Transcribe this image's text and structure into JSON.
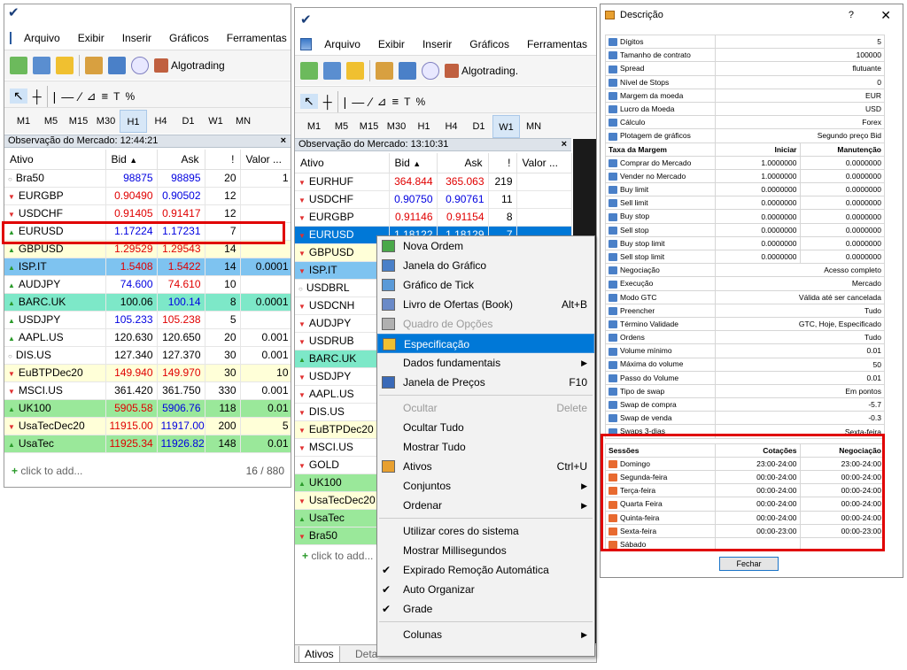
{
  "menu": {
    "items": [
      "Arquivo",
      "Exibir",
      "Inserir",
      "Gráficos",
      "Ferramentas"
    ]
  },
  "toolbar": {
    "algo_label": "Algotrading",
    "algo_label2": "Algotrading."
  },
  "timeframes": [
    "M1",
    "M5",
    "M15",
    "M30",
    "H1",
    "H4",
    "D1",
    "W1",
    "MN"
  ],
  "left": {
    "header": "Observação do Mercado: 12:44:21",
    "columns": [
      "Ativo",
      "Bid",
      "Ask",
      "!",
      "Valor ..."
    ],
    "rows": [
      {
        "sym": "Bra50",
        "bid": "98875",
        "ask": "98895",
        "s": "20",
        "v": "1",
        "dir": "nt",
        "bg": "#ffffff",
        "bidc": "blue",
        "askc": "blue"
      },
      {
        "sym": "EURGBP",
        "bid": "0.90490",
        "ask": "0.90502",
        "s": "12",
        "v": "",
        "dir": "dn",
        "bg": "#ffffff",
        "bidc": "red",
        "askc": "blue"
      },
      {
        "sym": "USDCHF",
        "bid": "0.91405",
        "ask": "0.91417",
        "s": "12",
        "v": "",
        "dir": "dn",
        "bg": "#ffffff",
        "bidc": "red",
        "askc": "red"
      },
      {
        "sym": "EURUSD",
        "bid": "1.17224",
        "ask": "1.17231",
        "s": "7",
        "v": "",
        "dir": "up",
        "bg": "#ffffff",
        "bidc": "blue",
        "askc": "blue"
      },
      {
        "sym": "GBPUSD",
        "bid": "1.29529",
        "ask": "1.29543",
        "s": "14",
        "v": "",
        "dir": "up",
        "bg": "#ffffd8",
        "bidc": "red",
        "askc": "red"
      },
      {
        "sym": "ISP.IT",
        "bid": "1.5408",
        "ask": "1.5422",
        "s": "14",
        "v": "0.0001",
        "dir": "up",
        "bg": "#7ec3f0",
        "bidc": "red",
        "askc": "red"
      },
      {
        "sym": "AUDJPY",
        "bid": "74.600",
        "ask": "74.610",
        "s": "10",
        "v": "",
        "dir": "up",
        "bg": "#ffffff",
        "bidc": "blue",
        "askc": "red"
      },
      {
        "sym": "BARC.UK",
        "bid": "100.06",
        "ask": "100.14",
        "s": "8",
        "v": "0.0001",
        "dir": "up",
        "bg": "#7de8c8",
        "bidc": "",
        "askc": "blue"
      },
      {
        "sym": "USDJPY",
        "bid": "105.233",
        "ask": "105.238",
        "s": "5",
        "v": "",
        "dir": "up",
        "bg": "#ffffff",
        "bidc": "blue",
        "askc": "red"
      },
      {
        "sym": "AAPL.US",
        "bid": "120.630",
        "ask": "120.650",
        "s": "20",
        "v": "0.001",
        "dir": "up",
        "bg": "#ffffff",
        "bidc": "",
        "askc": ""
      },
      {
        "sym": "DIS.US",
        "bid": "127.340",
        "ask": "127.370",
        "s": "30",
        "v": "0.001",
        "dir": "nt",
        "bg": "#ffffff",
        "bidc": "",
        "askc": ""
      },
      {
        "sym": "EuBTPDec20",
        "bid": "149.940",
        "ask": "149.970",
        "s": "30",
        "v": "10",
        "dir": "dn",
        "bg": "#ffffd8",
        "bidc": "red",
        "askc": "red"
      },
      {
        "sym": "MSCI.US",
        "bid": "361.420",
        "ask": "361.750",
        "s": "330",
        "v": "0.001",
        "dir": "dn",
        "bg": "#ffffff",
        "bidc": "",
        "askc": ""
      },
      {
        "sym": "UK100",
        "bid": "5905.58",
        "ask": "5906.76",
        "s": "118",
        "v": "0.01",
        "dir": "up",
        "bg": "#9ae89a",
        "bidc": "red",
        "askc": "blue"
      },
      {
        "sym": "UsaTecDec20",
        "bid": "11915.00",
        "ask": "11917.00",
        "s": "200",
        "v": "5",
        "dir": "dn",
        "bg": "#ffffd8",
        "bidc": "red",
        "askc": "blue"
      },
      {
        "sym": "UsaTec",
        "bid": "11925.34",
        "ask": "11926.82",
        "s": "148",
        "v": "0.01",
        "dir": "up",
        "bg": "#9ae89a",
        "bidc": "red",
        "askc": "blue"
      }
    ],
    "add": "click to add...",
    "count": "16 / 880"
  },
  "mid": {
    "header": "Observação do Mercado: 13:10:31",
    "columns": [
      "Ativo",
      "Bid",
      "Ask",
      "!",
      "Valor ..."
    ],
    "rows": [
      {
        "sym": "EURHUF",
        "bid": "364.844",
        "ask": "365.063",
        "s": "219",
        "dir": "dn",
        "bg": "#ffffff",
        "bidc": "red",
        "askc": "red"
      },
      {
        "sym": "USDCHF",
        "bid": "0.90750",
        "ask": "0.90761",
        "s": "11",
        "dir": "dn",
        "bg": "#ffffff",
        "bidc": "blue",
        "askc": "blue"
      },
      {
        "sym": "EURGBP",
        "bid": "0.91146",
        "ask": "0.91154",
        "s": "8",
        "dir": "dn",
        "bg": "#ffffff",
        "bidc": "red",
        "askc": "red"
      },
      {
        "sym": "EURUSD",
        "bid": "1.18122",
        "ask": "1.18129",
        "s": "7",
        "dir": "dn",
        "bg": "#0078d7",
        "bidc": "",
        "askc": ""
      },
      {
        "sym": "GBPUSD",
        "bid": "",
        "ask": "",
        "s": "",
        "dir": "dn",
        "bg": "#ffffd8",
        "bidc": "",
        "askc": ""
      },
      {
        "sym": "ISP.IT",
        "bid": "",
        "ask": "",
        "s": "",
        "dir": "dn",
        "bg": "#7ec3f0",
        "bidc": "",
        "askc": ""
      },
      {
        "sym": "USDBRL",
        "bid": "",
        "ask": "",
        "s": "",
        "dir": "nt",
        "bg": "#ffffff",
        "bidc": "",
        "askc": ""
      },
      {
        "sym": "USDCNH",
        "bid": "",
        "ask": "",
        "s": "",
        "dir": "dn",
        "bg": "#ffffff",
        "bidc": "",
        "askc": ""
      },
      {
        "sym": "AUDJPY",
        "bid": "",
        "ask": "",
        "s": "",
        "dir": "dn",
        "bg": "#ffffff",
        "bidc": "",
        "askc": ""
      },
      {
        "sym": "USDRUB",
        "bid": "",
        "ask": "",
        "s": "",
        "dir": "dn",
        "bg": "#ffffff",
        "bidc": "",
        "askc": ""
      },
      {
        "sym": "BARC.UK",
        "bid": "",
        "ask": "",
        "s": "",
        "dir": "up",
        "bg": "#7de8c8",
        "bidc": "",
        "askc": ""
      },
      {
        "sym": "USDJPY",
        "bid": "",
        "ask": "",
        "s": "",
        "dir": "dn",
        "bg": "#ffffff",
        "bidc": "",
        "askc": ""
      },
      {
        "sym": "AAPL.US",
        "bid": "",
        "ask": "",
        "s": "",
        "dir": "dn",
        "bg": "#ffffff",
        "bidc": "",
        "askc": ""
      },
      {
        "sym": "DIS.US",
        "bid": "",
        "ask": "",
        "s": "",
        "dir": "dn",
        "bg": "#ffffff",
        "bidc": "",
        "askc": ""
      },
      {
        "sym": "EuBTPDec20",
        "bid": "",
        "ask": "",
        "s": "",
        "dir": "dn",
        "bg": "#ffffd8",
        "bidc": "",
        "askc": ""
      },
      {
        "sym": "MSCI.US",
        "bid": "",
        "ask": "",
        "s": "",
        "dir": "dn",
        "bg": "#ffffff",
        "bidc": "",
        "askc": ""
      },
      {
        "sym": "GOLD",
        "bid": "",
        "ask": "",
        "s": "",
        "dir": "dn",
        "bg": "#ffffff",
        "bidc": "",
        "askc": ""
      },
      {
        "sym": "UK100",
        "bid": "",
        "ask": "",
        "s": "",
        "dir": "up",
        "bg": "#9ae89a",
        "bidc": "",
        "askc": ""
      },
      {
        "sym": "UsaTecDec20",
        "bid": "",
        "ask": "",
        "s": "",
        "dir": "dn",
        "bg": "#ffffd8",
        "bidc": "",
        "askc": ""
      },
      {
        "sym": "UsaTec",
        "bid": "",
        "ask": "",
        "s": "",
        "dir": "up",
        "bg": "#9ae89a",
        "bidc": "",
        "askc": ""
      },
      {
        "sym": "Bra50",
        "bid": "",
        "ask": "",
        "s": "",
        "dir": "dn",
        "bg": "#9ae89a",
        "bidc": "",
        "askc": ""
      }
    ],
    "add": "click to add...",
    "tabs": [
      "Ativos",
      "Deta"
    ]
  },
  "context": {
    "items": [
      {
        "label": "Nova Ordem",
        "shortcut": "",
        "icon": "new-order-icon",
        "type": "item"
      },
      {
        "label": "Janela do Gráfico",
        "shortcut": "",
        "icon": "chart-window-icon",
        "type": "item"
      },
      {
        "label": "Gráfico de Tick",
        "shortcut": "",
        "icon": "tick-chart-icon",
        "type": "item"
      },
      {
        "label": "Livro de Ofertas (Book)",
        "shortcut": "Alt+B",
        "icon": "order-book-icon",
        "type": "item"
      },
      {
        "label": "Quadro de Opções",
        "shortcut": "",
        "icon": "options-board-icon",
        "type": "disabled"
      },
      {
        "label": "Especificação",
        "shortcut": "",
        "icon": "specification-icon",
        "type": "selected"
      },
      {
        "label": "Dados fundamentais",
        "shortcut": "",
        "icon": "",
        "type": "submenu"
      },
      {
        "label": "Janela de Preços",
        "shortcut": "F10",
        "icon": "price-window-icon",
        "type": "item"
      },
      {
        "type": "sep"
      },
      {
        "label": "Ocultar",
        "shortcut": "Delete",
        "icon": "",
        "type": "disabled"
      },
      {
        "label": "Ocultar Tudo",
        "shortcut": "",
        "icon": "",
        "type": "item"
      },
      {
        "label": "Mostrar Tudo",
        "shortcut": "",
        "icon": "",
        "type": "item"
      },
      {
        "label": "Ativos",
        "shortcut": "Ctrl+U",
        "icon": "symbols-icon",
        "type": "item"
      },
      {
        "label": "Conjuntos",
        "shortcut": "",
        "icon": "",
        "type": "submenu"
      },
      {
        "label": "Ordenar",
        "shortcut": "",
        "icon": "",
        "type": "submenu"
      },
      {
        "type": "sep"
      },
      {
        "label": "Utilizar cores do sistema",
        "shortcut": "",
        "icon": "",
        "type": "item"
      },
      {
        "label": "Mostrar Millisegundos",
        "shortcut": "",
        "icon": "",
        "type": "item"
      },
      {
        "label": "Expirado Remoção Automática",
        "shortcut": "",
        "icon": "check-icon",
        "type": "check"
      },
      {
        "label": "Auto Organizar",
        "shortcut": "",
        "icon": "check-icon",
        "type": "check"
      },
      {
        "label": "Grade",
        "shortcut": "",
        "icon": "check-icon",
        "type": "check"
      },
      {
        "type": "sep"
      },
      {
        "label": "Colunas",
        "shortcut": "",
        "icon": "",
        "type": "submenu"
      }
    ]
  },
  "dialog": {
    "title": "Descrição",
    "help": "?",
    "close": "✕",
    "props": [
      [
        "Dígitos",
        "5"
      ],
      [
        "Tamanho de contrato",
        "100000"
      ],
      [
        "Spread",
        "flutuante"
      ],
      [
        "Nível de Stops",
        "0"
      ],
      [
        "Margem da moeda",
        "EUR"
      ],
      [
        "Lucro da Moeda",
        "USD"
      ],
      [
        "Cálculo",
        "Forex"
      ],
      [
        "Plotagem de gráficos",
        "Segundo preço Bid"
      ]
    ],
    "margin_header": [
      "Taxa da Margem",
      "Iniciar",
      "Manutenção"
    ],
    "margins": [
      [
        "Comprar do Mercado",
        "1.0000000",
        "0.0000000"
      ],
      [
        "Vender no Mercado",
        "1.0000000",
        "0.0000000"
      ],
      [
        "Buy limit",
        "0.0000000",
        "0.0000000"
      ],
      [
        "Sell limit",
        "0.0000000",
        "0.0000000"
      ],
      [
        "Buy stop",
        "0.0000000",
        "0.0000000"
      ],
      [
        "Sell stop",
        "0.0000000",
        "0.0000000"
      ],
      [
        "Buy stop limit",
        "0.0000000",
        "0.0000000"
      ],
      [
        "Sell stop limit",
        "0.0000000",
        "0.0000000"
      ]
    ],
    "props2": [
      [
        "Negociação",
        "Acesso completo"
      ],
      [
        "Execução",
        "Mercado"
      ],
      [
        "Modo GTC",
        "Válida até ser cancelada"
      ],
      [
        "Preencher",
        "Tudo"
      ],
      [
        "Término Validade",
        "GTC, Hoje, Especificado"
      ],
      [
        "Ordens",
        "Tudo"
      ],
      [
        "Volume mínimo",
        "0.01"
      ],
      [
        "Máxima do volume",
        "50"
      ],
      [
        "Passo do Volume",
        "0.01"
      ],
      [
        "Tipo de swap",
        "Em pontos"
      ],
      [
        "Swap de compra",
        "-5.7"
      ],
      [
        "Swap de venda",
        "-0.3"
      ],
      [
        "Swaps 3-dias",
        "Sexta-feira"
      ]
    ],
    "sessions_header": [
      "Sessões",
      "Cotações",
      "Negociação"
    ],
    "sessions": [
      [
        "Domingo",
        "23:00-24:00",
        "23:00-24:00"
      ],
      [
        "Segunda-feira",
        "00:00-24:00",
        "00:00-24:00"
      ],
      [
        "Terça-feira",
        "00:00-24:00",
        "00:00-24:00"
      ],
      [
        "Quarta Feira",
        "00:00-24:00",
        "00:00-24:00"
      ],
      [
        "Quinta-feira",
        "00:00-24:00",
        "00:00-24:00"
      ],
      [
        "Sexta-feira",
        "00:00-23:00",
        "00:00-23:00"
      ],
      [
        "Sábado",
        "",
        ""
      ]
    ],
    "button": "Fechar"
  },
  "colors": {
    "highlight": "#e00000",
    "selection": "#0078d7"
  }
}
